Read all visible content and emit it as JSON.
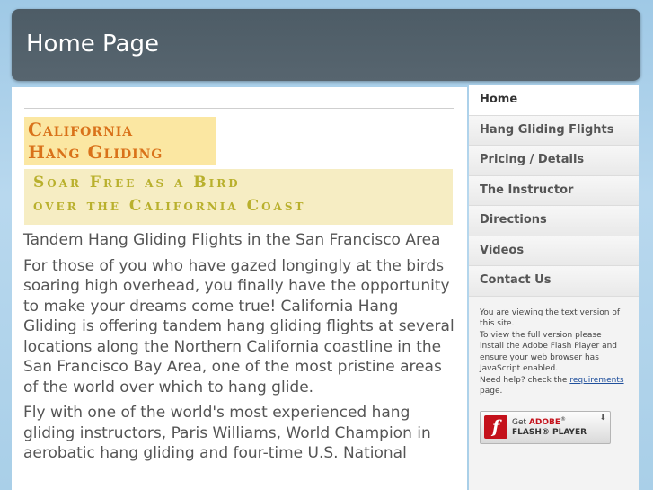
{
  "header": {
    "title": "Home Page"
  },
  "banner": {
    "line1": "California",
    "line2": "Hang Gliding",
    "tagline1": "Soar Free as a Bird",
    "tagline2": "over the California Coast"
  },
  "main": {
    "heading": "Tandem Hang Gliding Flights in the San Francisco Area",
    "paragraphs": [
      "For those of you who have gazed longingly at the birds soaring high overhead, you finally have the opportunity to make your dreams come true! California Hang Gliding is offering tandem hang gliding flights at several locations along the Northern California coastline in the San Francisco Bay Area, one of the most pristine areas of the world over which to hang glide.",
      "Fly with one of the world's most experienced hang gliding instructors, Paris Williams, World Champion in aerobatic hang gliding and four-time U.S. National"
    ]
  },
  "sidebar": {
    "nav": [
      {
        "label": "Home"
      },
      {
        "label": "Hang Gliding Flights"
      },
      {
        "label": "Pricing / Details"
      },
      {
        "label": "The Instructor"
      },
      {
        "label": "Directions"
      },
      {
        "label": "Videos"
      },
      {
        "label": "Contact Us"
      }
    ],
    "info": {
      "line1": "You are viewing the text version of this site.",
      "line2": "To view the full version please install the Adobe Flash Player and ensure your web browser has JavaScript enabled.",
      "line3_prefix": "Need help? check the ",
      "link": "requirements",
      "line3_suffix": " page."
    },
    "flash_badge": {
      "get": "Get",
      "adobe": "ADOBE",
      "reg": "®",
      "player": "FLASH® PLAYER",
      "logo_glyph": "f",
      "arrow": "⬇"
    }
  }
}
